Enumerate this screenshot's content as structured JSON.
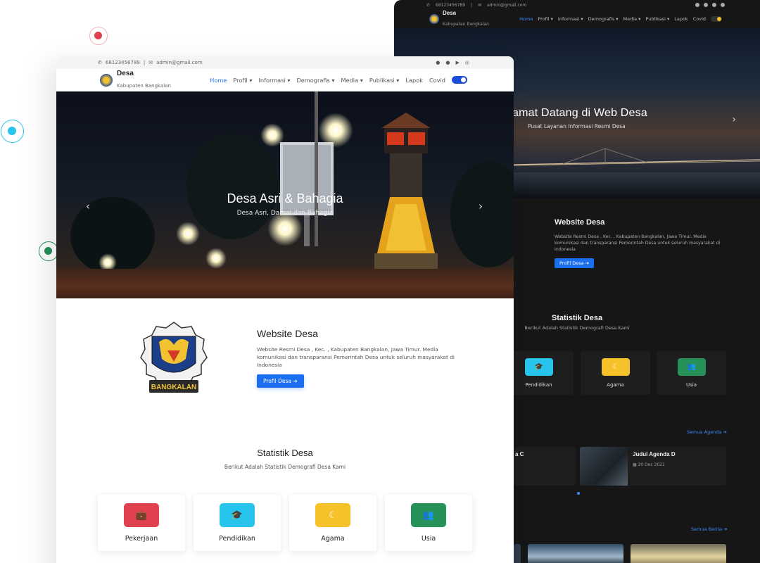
{
  "contact": {
    "phone": "68123456789",
    "separator": "|",
    "email": "admin@gmail.com"
  },
  "brand": {
    "title": "Desa",
    "subtitle": "Kabupaten Bangkalan"
  },
  "nav": {
    "items": [
      {
        "label": "Home",
        "active": true
      },
      {
        "label": "Profil ▾",
        "active": false
      },
      {
        "label": "Informasi ▾",
        "active": false
      },
      {
        "label": "Demografis ▾",
        "active": false
      },
      {
        "label": "Media ▾",
        "active": false
      },
      {
        "label": "Publikasi ▾",
        "active": false
      },
      {
        "label": "Lapok",
        "active": false
      },
      {
        "label": "Covid",
        "active": false
      }
    ]
  },
  "light": {
    "hero": {
      "title": "Desa Asri & Bahagia",
      "subtitle": "Desa Asri, Damai dan Bahagia"
    },
    "about": {
      "title": "Website Desa",
      "text": "Website Resmi Desa , Kec. , Kabupaten Bangkalan, Jawa Timur. Media komunikasi dan transparansi Pemerintah Desa untuk seluruh masyarakat di Indonesia",
      "button": "Profil Desa ➔",
      "logo_caption": "BANGKALAN"
    },
    "stats": {
      "title": "Statistik Desa",
      "subtitle": "Berikut Adalah Statistik Demografi Desa Kami",
      "cards": [
        {
          "label": "Pekerjaan",
          "icon": "briefcase-icon",
          "color": "#e0414f",
          "glyph": "💼"
        },
        {
          "label": "Pendidikan",
          "icon": "graduation-cap-icon",
          "color": "#27c4ec",
          "glyph": "🎓"
        },
        {
          "label": "Agama",
          "icon": "moon-icon",
          "color": "#f7c12a",
          "glyph": "☾"
        },
        {
          "label": "Usia",
          "icon": "people-icon",
          "color": "#27915a",
          "glyph": "👥"
        }
      ]
    }
  },
  "dark": {
    "hero": {
      "title": "amat Datang di Web Desa",
      "subtitle": "Pusat Layanan Informasi Resmi Desa"
    },
    "about": {
      "title": "Website Desa",
      "text": "Website Resmi Desa , Kec. , Kabupaten Bangkalan, Jawa Timur. Media komunikasi dan transparansi Pemerintah Desa untuk seluruh masyarakat di Indonesia",
      "button": "Profil Desa ➔"
    },
    "stats": {
      "title": "Statistik Desa",
      "subtitle": "Berikut Adalah Statistik Demografi Desa Kami",
      "cards": [
        {
          "label": "Pendidikan",
          "icon": "graduation-cap-icon",
          "color": "#27c4ec",
          "glyph": "🎓"
        },
        {
          "label": "Agama",
          "icon": "moon-icon",
          "color": "#f7c12a",
          "glyph": "☾"
        },
        {
          "label": "Usia",
          "icon": "people-icon",
          "color": "#27915a",
          "glyph": "👥"
        }
      ]
    },
    "agenda": {
      "all_link": "Semua Agenda ➔",
      "items": [
        {
          "title": "a C",
          "date": ""
        },
        {
          "title": "Judul Agenda D",
          "date": "▦ 20 Dec 2021"
        }
      ]
    },
    "news": {
      "all_link": "Semua Berita ➔"
    }
  },
  "colors": {
    "accent": "#1a6ff0",
    "ring_red": "#e0414f",
    "ring_cyan": "#27c4ec",
    "ring_green": "#27915a"
  }
}
